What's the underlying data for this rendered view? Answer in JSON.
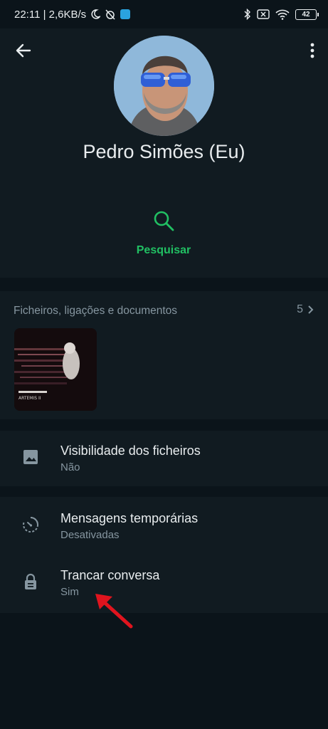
{
  "status_bar": {
    "time_speed": "22:11 | 2,6KB/s",
    "battery": "42"
  },
  "header": {
    "profile_name": "Pedro Simões (Eu)",
    "search_label": "Pesquisar"
  },
  "media": {
    "title": "Ficheiros, ligações e documentos",
    "count": "5",
    "thumb_caption": "ARTEMIS II"
  },
  "settings": {
    "visibility": {
      "title": "Visibilidade dos ficheiros",
      "value": "Não"
    },
    "temporary": {
      "title": "Mensagens temporárias",
      "value": "Desativadas"
    },
    "lock": {
      "title": "Trancar conversa",
      "value": "Sim"
    }
  },
  "colors": {
    "accent": "#21c063",
    "background": "#0b141a",
    "surface": "#111b21",
    "annotation_arrow": "#e0141e"
  }
}
